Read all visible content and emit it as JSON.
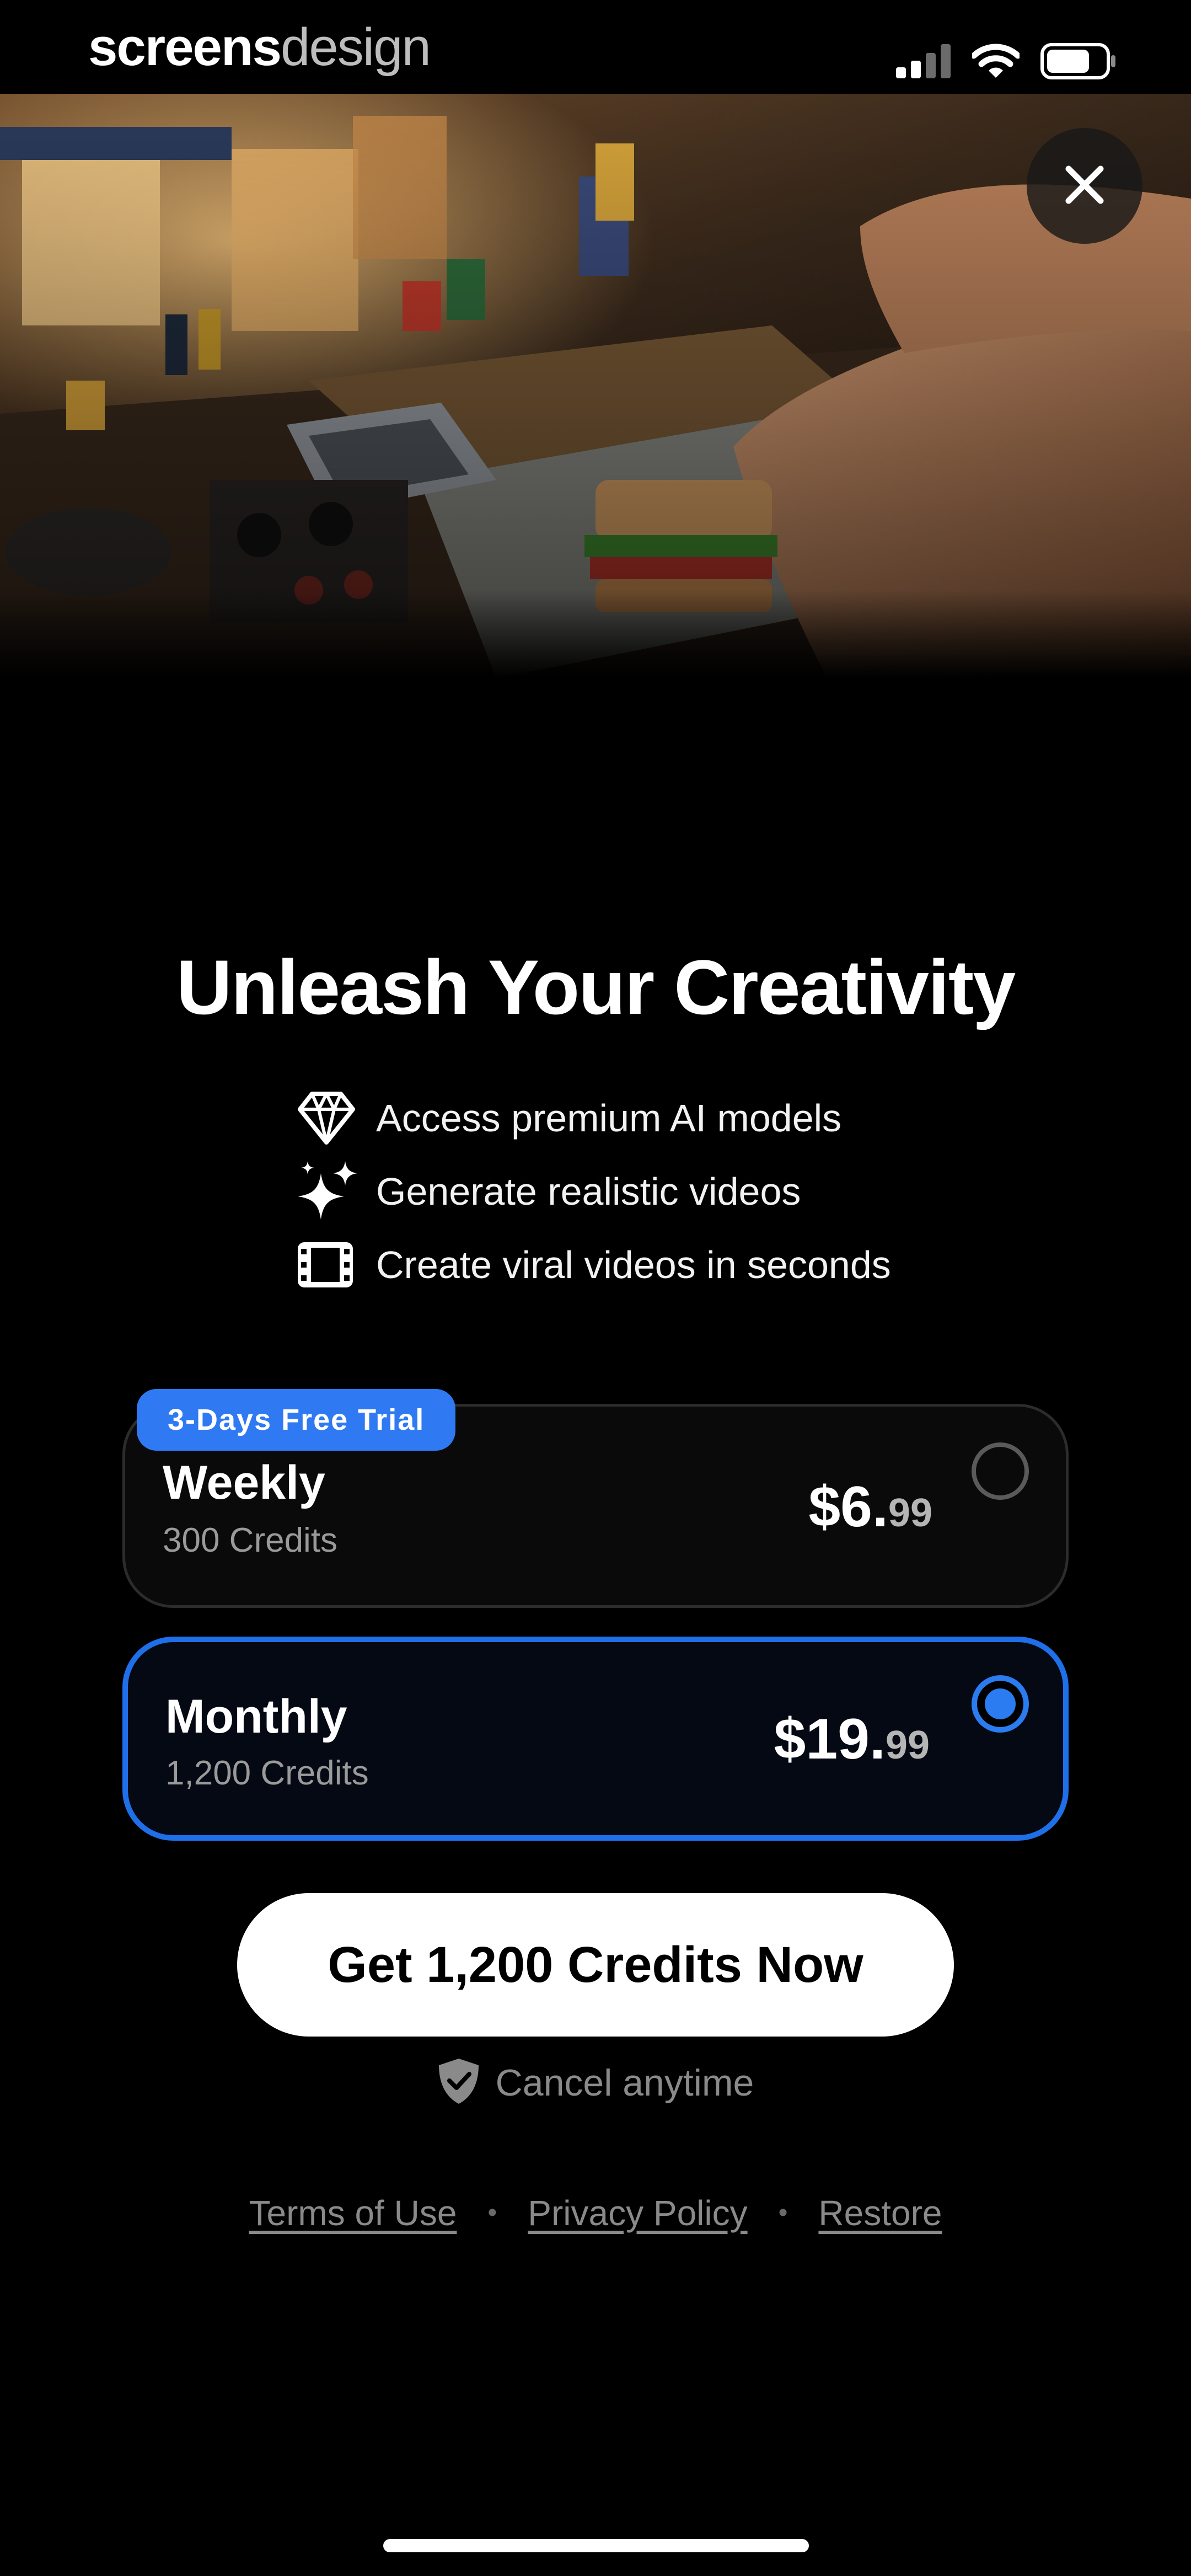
{
  "status_bar": {
    "watermark_part1": "screens",
    "watermark_part2": "design",
    "icons": [
      "cellular-signal-icon",
      "wifi-icon",
      "battery-icon"
    ]
  },
  "hero": {
    "image": "lego-kitchen-sandwich-photo",
    "close_icon": "close-icon"
  },
  "main": {
    "title": "Unleash Your Creativity",
    "features": [
      {
        "icon": "diamond-icon",
        "label": "Access premium AI models"
      },
      {
        "icon": "sparkles-icon",
        "label": "Generate realistic videos"
      },
      {
        "icon": "film-icon",
        "label": "Create viral videos in seconds"
      }
    ]
  },
  "plans": [
    {
      "badge": "3-Days Free Trial",
      "name": "Weekly",
      "credits": "300 Credits",
      "price_main": "$6.",
      "price_cents": "99",
      "selected": false
    },
    {
      "name": "Monthly",
      "credits": "1,200 Credits",
      "price_main": "$19.",
      "price_cents": "99",
      "selected": true
    }
  ],
  "cta": {
    "label": "Get 1,200 Credits Now",
    "cancel_text": "Cancel anytime"
  },
  "footer": {
    "links": [
      "Terms of Use",
      "Privacy Policy",
      "Restore"
    ],
    "separator": "•"
  },
  "colors": {
    "background": "#000000",
    "accent": "#2a7cf0",
    "badge": "#2f7af3",
    "cta_background": "#ffffff",
    "muted_text": "#8a8a8a"
  }
}
